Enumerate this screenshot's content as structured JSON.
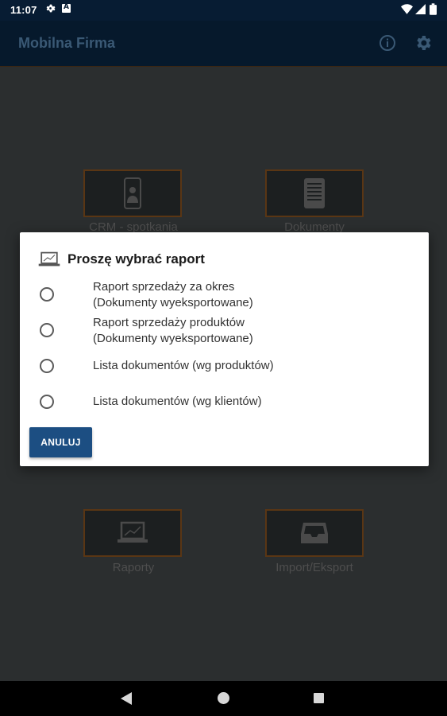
{
  "status_bar": {
    "time": "11:07",
    "icons": [
      "gear-icon",
      "a-notification-icon",
      "wifi-icon",
      "signal-icon",
      "battery-icon"
    ]
  },
  "app_bar": {
    "title": "Mobilna Firma",
    "actions": [
      "info-icon",
      "settings-icon"
    ]
  },
  "tiles": [
    {
      "label": "CRM - spotkania",
      "icon": "person-phone-icon"
    },
    {
      "label": "Dokumenty",
      "icon": "document-icon"
    },
    {
      "label": "Raporty",
      "icon": "laptop-chart-icon"
    },
    {
      "label": "Import/Eksport",
      "icon": "inbox-tray-icon"
    }
  ],
  "dialog": {
    "title": "Proszę wybrać raport",
    "icon": "laptop-chart-icon",
    "options": [
      {
        "label": "Raport sprzedaży za okres\n(Dokumenty wyeksportowane)",
        "selected": false
      },
      {
        "label": "Raport sprzedaży produktów\n(Dokumenty wyeksportowane)",
        "selected": false
      },
      {
        "label": "Lista dokumentów (wg produktów)",
        "selected": false
      },
      {
        "label": "Lista dokumentów (wg klientów)",
        "selected": false
      }
    ],
    "cancel_label": "ANULUJ"
  },
  "colors": {
    "status_bar": "#071c33",
    "app_bar": "#06192c",
    "accent_button": "#1c4e82",
    "tile_border": "#5a3614",
    "background": "#2b2e2f"
  },
  "nav_bar": {
    "buttons": [
      "back-icon",
      "home-icon",
      "recent-apps-icon"
    ]
  }
}
